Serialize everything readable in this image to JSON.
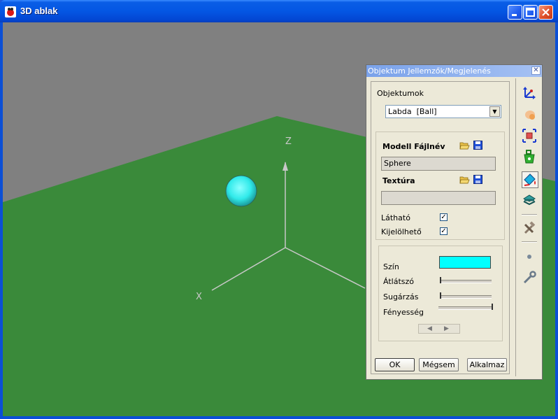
{
  "window": {
    "title": "3D ablak",
    "accent": "#0a5ee6",
    "close_label": "✕"
  },
  "scene": {
    "sky_color": "#808080",
    "ground_color": "#3a8a3a",
    "ball_color": "#40f0f0",
    "axis_labels": {
      "x": "X",
      "z": "Z"
    }
  },
  "dialog": {
    "title": "Objektum Jellemzők/Megjelenés",
    "close_label": "✕",
    "objects_label": "Objektumok",
    "selected_object": "Labda  [Ball]",
    "model_filename_label": "Modell Fájlnév",
    "model_filename_value": "Sphere",
    "texture_label": "Textúra",
    "texture_value": "",
    "visible_label": "Látható",
    "visible_checked": true,
    "selectable_label": "Kijelölhető",
    "selectable_checked": true,
    "color_label": "Szín",
    "color_value": "#00ffff",
    "transparency_label": "Átlátszó",
    "transparency_level": 0,
    "radiance_label": "Sugárzás",
    "radiance_level": 0,
    "brightness_label": "Fényesség",
    "brightness_level": 1,
    "ok_label": "OK",
    "cancel_label": "Mégsem",
    "apply_label": "Alkalmaz"
  },
  "toolbar": {
    "icons": [
      "axes-icon",
      "brush-icon",
      "resize-icon",
      "weight-icon",
      "paint-bucket-icon",
      "layers-icon",
      "tools-icon",
      "dot-icon",
      "wrench-icon"
    ]
  }
}
